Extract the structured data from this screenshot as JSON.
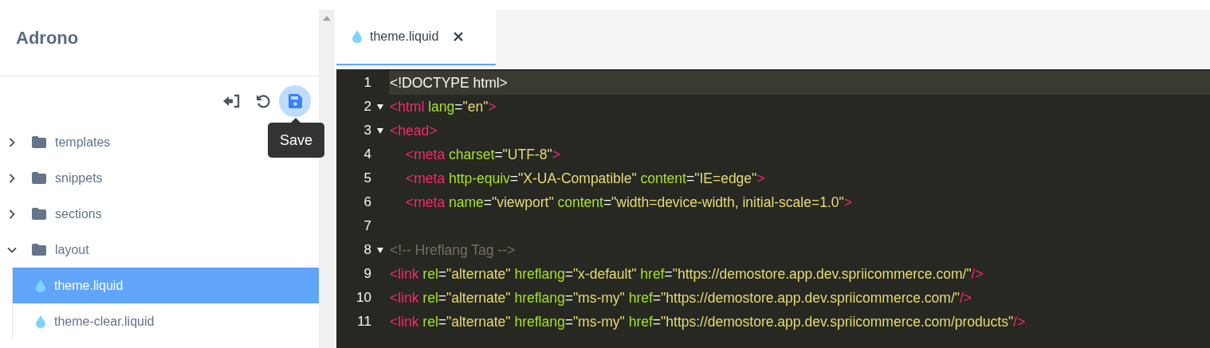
{
  "sidebar": {
    "title": "Adrono",
    "toolbar": [
      {
        "kind": "exit",
        "hovered": false
      },
      {
        "kind": "undo",
        "hovered": false
      },
      {
        "kind": "save",
        "hovered": true
      }
    ],
    "tooltip": "Save",
    "tree": [
      {
        "name": "templates",
        "expanded": false
      },
      {
        "name": "snippets",
        "expanded": false
      },
      {
        "name": "sections",
        "expanded": false
      },
      {
        "name": "layout",
        "expanded": true,
        "children": [
          {
            "name": "theme.liquid",
            "selected": true
          },
          {
            "name": "theme-clear.liquid",
            "selected": false
          }
        ]
      }
    ]
  },
  "tabs": [
    {
      "label": "theme.liquid",
      "selected": true
    }
  ],
  "code": [
    {
      "number": "1",
      "fold": false,
      "current": true,
      "indented": false,
      "tokens": [
        {
          "kind": "text",
          "t": "<!DOCTYPE html>"
        }
      ]
    },
    {
      "number": "2",
      "fold": true,
      "current": false,
      "indented": false,
      "tokens": [
        {
          "kind": "tag",
          "t": "<html"
        },
        {
          "kind": "attr",
          "t": " lang"
        },
        {
          "kind": "text",
          "t": "="
        },
        {
          "kind": "str",
          "t": "\"en\""
        },
        {
          "kind": "tag",
          "t": ">"
        }
      ]
    },
    {
      "number": "3",
      "fold": true,
      "current": false,
      "indented": false,
      "tokens": [
        {
          "kind": "tag",
          "t": "<head>"
        }
      ]
    },
    {
      "number": "4",
      "fold": false,
      "current": false,
      "indented": true,
      "tokens": [
        {
          "kind": "tag",
          "t": "<meta"
        },
        {
          "kind": "attr",
          "t": " charset"
        },
        {
          "kind": "text",
          "t": "="
        },
        {
          "kind": "str",
          "t": "\"UTF-8\""
        },
        {
          "kind": "tag",
          "t": ">"
        }
      ]
    },
    {
      "number": "5",
      "fold": false,
      "current": false,
      "indented": true,
      "tokens": [
        {
          "kind": "tag",
          "t": "<meta"
        },
        {
          "kind": "attr",
          "t": " http-equiv"
        },
        {
          "kind": "text",
          "t": "="
        },
        {
          "kind": "str",
          "t": "\"X-UA-Compatible\""
        },
        {
          "kind": "attr",
          "t": " content"
        },
        {
          "kind": "text",
          "t": "="
        },
        {
          "kind": "str",
          "t": "\"IE=edge\""
        },
        {
          "kind": "tag",
          "t": ">"
        }
      ]
    },
    {
      "number": "6",
      "fold": false,
      "current": false,
      "indented": true,
      "tokens": [
        {
          "kind": "tag",
          "t": "<meta"
        },
        {
          "kind": "attr",
          "t": " name"
        },
        {
          "kind": "text",
          "t": "="
        },
        {
          "kind": "str",
          "t": "\"viewport\""
        },
        {
          "kind": "attr",
          "t": " content"
        },
        {
          "kind": "text",
          "t": "="
        },
        {
          "kind": "str",
          "t": "\"width=device-width, initial-scale=1.0\""
        },
        {
          "kind": "tag",
          "t": ">"
        }
      ]
    },
    {
      "number": "7",
      "fold": false,
      "current": false
    },
    {
      "number": "8",
      "fold": true,
      "current": false,
      "indented": false,
      "tokens": [
        {
          "kind": "comment",
          "t": "<!-- Hreflang Tag -->"
        }
      ]
    },
    {
      "number": "9",
      "fold": false,
      "current": false,
      "indented": false,
      "tokens": [
        {
          "kind": "tag",
          "t": "<link"
        },
        {
          "kind": "attr",
          "t": " rel"
        },
        {
          "kind": "text",
          "t": "="
        },
        {
          "kind": "str",
          "t": "\"alternate\""
        },
        {
          "kind": "attr",
          "t": " hreflang"
        },
        {
          "kind": "text",
          "t": "="
        },
        {
          "kind": "str",
          "t": "\"x-default\""
        },
        {
          "kind": "attr",
          "t": " href"
        },
        {
          "kind": "text",
          "t": "="
        },
        {
          "kind": "str",
          "t": "\"https://demostore.app.dev.spriicommerce.com/\""
        },
        {
          "kind": "tag",
          "t": "/>"
        }
      ]
    },
    {
      "number": "10",
      "fold": false,
      "current": false,
      "indented": false,
      "tokens": [
        {
          "kind": "tag",
          "t": "<link"
        },
        {
          "kind": "attr",
          "t": " rel"
        },
        {
          "kind": "text",
          "t": "="
        },
        {
          "kind": "str",
          "t": "\"alternate\""
        },
        {
          "kind": "attr",
          "t": " hreflang"
        },
        {
          "kind": "text",
          "t": "="
        },
        {
          "kind": "str",
          "t": "\"ms-my\""
        },
        {
          "kind": "attr",
          "t": " href"
        },
        {
          "kind": "text",
          "t": "="
        },
        {
          "kind": "str",
          "t": "\"https://demostore.app.dev.spriicommerce.com/\""
        },
        {
          "kind": "tag",
          "t": "/>"
        }
      ]
    },
    {
      "number": "11",
      "fold": false,
      "current": false,
      "indented": false,
      "tokens": [
        {
          "kind": "tag",
          "t": "<link"
        },
        {
          "kind": "attr",
          "t": " rel"
        },
        {
          "kind": "text",
          "t": "="
        },
        {
          "kind": "str",
          "t": "\"alternate\""
        },
        {
          "kind": "attr",
          "t": " hreflang"
        },
        {
          "kind": "text",
          "t": "="
        },
        {
          "kind": "str",
          "t": "\"ms-my\""
        },
        {
          "kind": "attr",
          "t": " href"
        },
        {
          "kind": "text",
          "t": "="
        },
        {
          "kind": "str",
          "t": "\"https://demostore.app.dev.spriicommerce.com/products\""
        },
        {
          "kind": "tag",
          "t": "/>"
        }
      ]
    }
  ]
}
